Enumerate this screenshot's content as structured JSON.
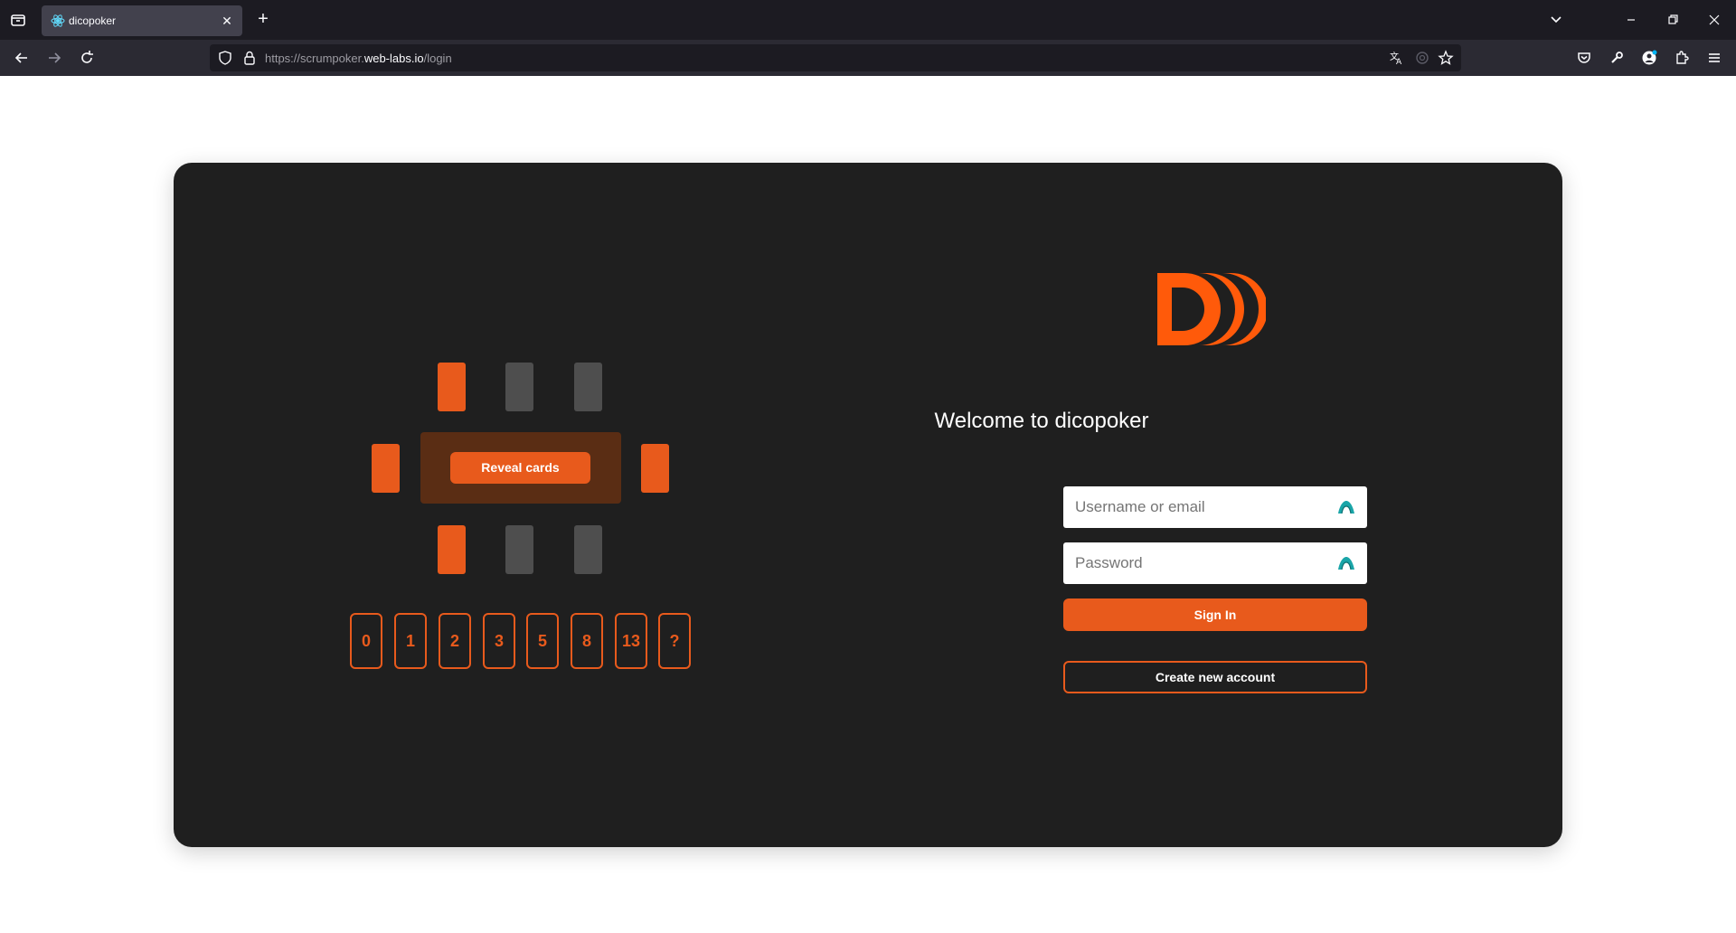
{
  "browser": {
    "tab_title": "dicopoker",
    "tab_close": "✕",
    "new_tab": "+",
    "url_prefix": "https://scrumpoker.",
    "url_domain": "web-labs.io",
    "url_path": "/login",
    "icons": [
      "tab-list-icon",
      "favicon",
      "close-icon",
      "new-tab-icon",
      "chevron-down-icon",
      "minimize-icon",
      "restore-icon",
      "window-close-icon",
      "back-icon",
      "forward-icon",
      "reload-icon",
      "shield-icon",
      "lock-icon",
      "translate-icon",
      "extension-icon",
      "star-icon",
      "pocket-icon",
      "wrench-icon",
      "account-icon",
      "extensions-icon",
      "menu-icon"
    ]
  },
  "illustration": {
    "reveal_label": "Reveal cards",
    "vote_cards": [
      "0",
      "1",
      "2",
      "3",
      "5",
      "8",
      "13",
      "?"
    ]
  },
  "login": {
    "welcome": "Welcome to dicopoker",
    "username_placeholder": "Username or email",
    "password_placeholder": "Password",
    "signin_label": "Sign In",
    "create_label": "Create new account"
  },
  "colors": {
    "accent": "#e85a1c",
    "card_bg": "#1f1f1f",
    "seat_gray": "#4e4e4e",
    "table_bg": "#5a2d14"
  }
}
